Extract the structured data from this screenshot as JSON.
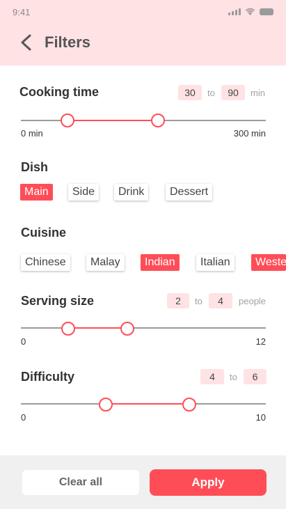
{
  "status_bar": {
    "time": "9:41"
  },
  "header": {
    "title": "Filters",
    "back_icon": "chevron-left-icon"
  },
  "cooking_time": {
    "title": "Cooking time",
    "from": "30",
    "to_label": "to",
    "to": "90",
    "unit": "min",
    "min_label": "0 min",
    "max_label": "300 min",
    "range_min": 0,
    "range_max": 300
  },
  "dish": {
    "title": "Dish",
    "options": [
      "Main",
      "Side",
      "Drink",
      "Dessert"
    ],
    "selected": "Main"
  },
  "cuisine": {
    "title": "Cuisine",
    "options": [
      "Chinese",
      "Malay",
      "Indian",
      "Italian",
      "Weste"
    ],
    "selected": [
      "Indian",
      "Weste"
    ]
  },
  "serving_size": {
    "title": "Serving size",
    "from": "2",
    "to_label": "to",
    "to": "4",
    "unit": "people",
    "min_label": "0",
    "max_label": "12",
    "range_min": 0,
    "range_max": 12
  },
  "difficulty": {
    "title": "Difficulty",
    "from": "4",
    "to_label": "to",
    "to": "6",
    "min_label": "0",
    "max_label": "10",
    "range_min": 0,
    "range_max": 10
  },
  "footer": {
    "clear_label": "Clear all",
    "apply_label": "Apply"
  },
  "colors": {
    "accent": "#ff4d57",
    "header_bg": "#ffe2e4",
    "footer_bg": "#f0f0f0"
  }
}
